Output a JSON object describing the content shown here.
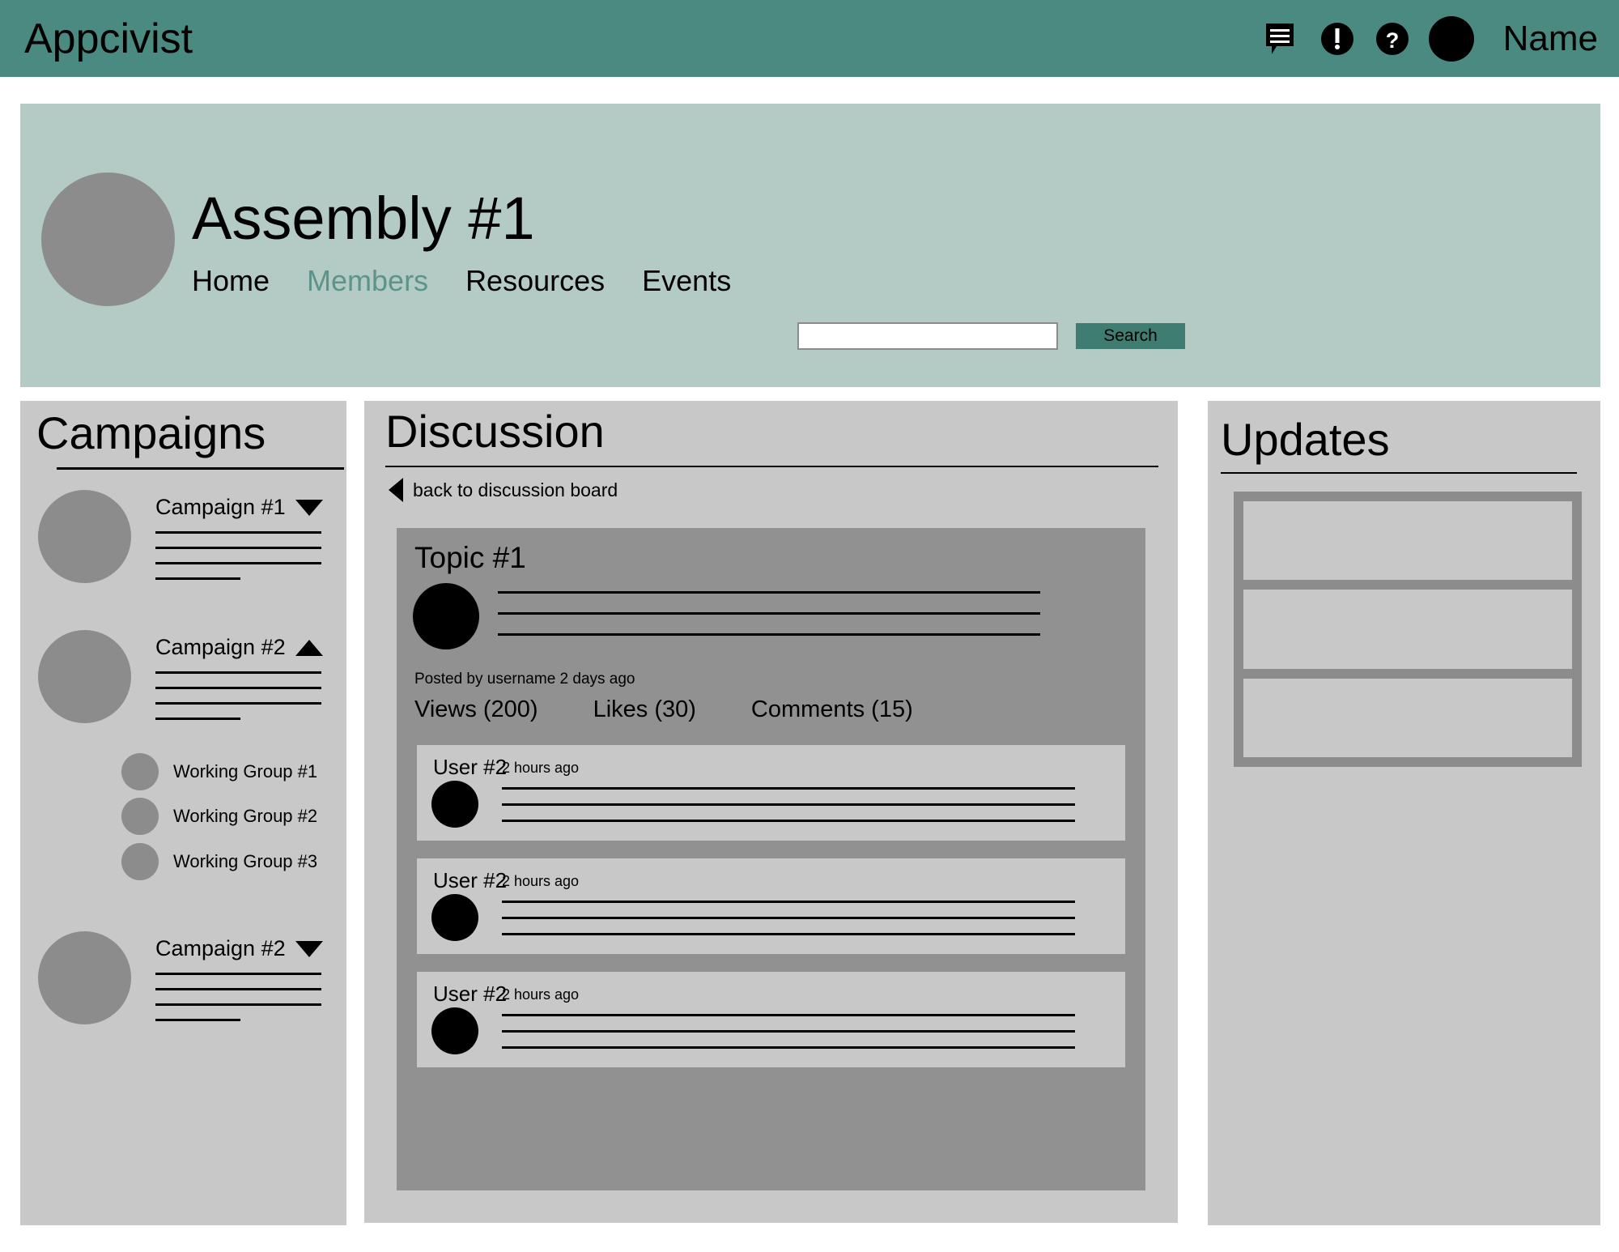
{
  "topbar": {
    "brand": "Appcivist",
    "icons": [
      {
        "name": "messages-icon",
        "glyph": "message-bubble"
      },
      {
        "name": "alerts-icon",
        "glyph": "exclamation-circle"
      },
      {
        "name": "help-icon",
        "glyph": "question-circle"
      }
    ],
    "user_name": "Name",
    "bg_color": "#4b8a80"
  },
  "hero": {
    "title": "Assembly #1",
    "bg_color": "#b3cbc4",
    "nav": [
      {
        "label": "Home",
        "active": false
      },
      {
        "label": "Members",
        "active": true
      },
      {
        "label": "Resources",
        "active": false
      },
      {
        "label": "Events",
        "active": false
      }
    ],
    "active_color": "#5c938a"
  },
  "search": {
    "value": "",
    "placeholder": "",
    "button_label": "Search",
    "button_color": "#3f7d73"
  },
  "campaigns": {
    "title": "Campaigns",
    "items": [
      {
        "label": "Campaign #1",
        "state": "collapsed",
        "caret": "down"
      },
      {
        "label": "Campaign #2",
        "state": "expanded",
        "caret": "up"
      },
      {
        "label": "Campaign #2",
        "state": "collapsed",
        "caret": "down"
      }
    ],
    "working_groups": [
      {
        "label": "Working Group #1"
      },
      {
        "label": "Working Group #2"
      },
      {
        "label": "Working Group #3"
      }
    ]
  },
  "discussion": {
    "title": "Discussion",
    "back_link": "back to discussion board",
    "topic": {
      "title": "Topic #1",
      "posted_meta": "Posted by username 2 days ago",
      "stats": [
        {
          "label": "Views (200)"
        },
        {
          "label": "Likes (30)"
        },
        {
          "label": "Comments (15)"
        }
      ]
    },
    "comments": [
      {
        "user": "User #2",
        "time": "2 hours ago"
      },
      {
        "user": "User #2",
        "time": "2 hours ago"
      },
      {
        "user": "User #2",
        "time": "2 hours ago"
      }
    ]
  },
  "updates": {
    "title": "Updates",
    "cells": [
      {},
      {},
      {}
    ]
  }
}
